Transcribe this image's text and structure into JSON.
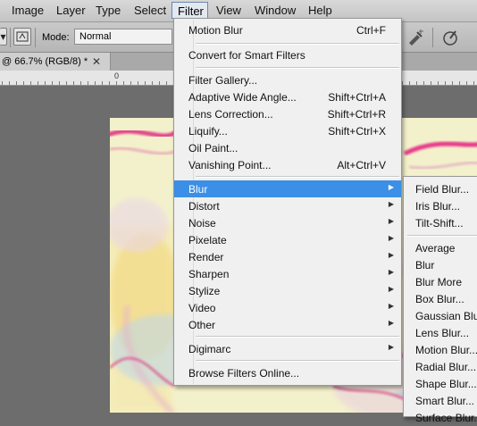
{
  "menubar": {
    "items": [
      "Image",
      "Layer",
      "Type",
      "Select",
      "Filter",
      "View",
      "Window",
      "Help"
    ],
    "active": "Filter"
  },
  "options_bar": {
    "mode_label": "Mode:",
    "mode_value": "Normal"
  },
  "document": {
    "tab_title": "@ 66.7% (RGB/8) *",
    "ruler_zero": "0"
  },
  "filter_menu": {
    "last_filter": {
      "label": "Motion Blur",
      "shortcut": "Ctrl+F"
    },
    "convert": "Convert for Smart Filters",
    "gallery_items": [
      {
        "label": "Filter Gallery...",
        "shortcut": ""
      },
      {
        "label": "Adaptive Wide Angle...",
        "shortcut": "Shift+Ctrl+A"
      },
      {
        "label": "Lens Correction...",
        "shortcut": "Shift+Ctrl+R"
      },
      {
        "label": "Liquify...",
        "shortcut": "Shift+Ctrl+X"
      },
      {
        "label": "Oil Paint...",
        "shortcut": ""
      },
      {
        "label": "Vanishing Point...",
        "shortcut": "Alt+Ctrl+V"
      }
    ],
    "submenus": [
      "Blur",
      "Distort",
      "Noise",
      "Pixelate",
      "Render",
      "Sharpen",
      "Stylize",
      "Video",
      "Other"
    ],
    "highlighted": "Blur",
    "digimarc": "Digimarc",
    "browse": "Browse Filters Online..."
  },
  "blur_menu": {
    "group1": [
      "Field Blur...",
      "Iris Blur...",
      "Tilt-Shift..."
    ],
    "group2": [
      "Average",
      "Blur",
      "Blur More",
      "Box Blur...",
      "Gaussian Blur...",
      "Lens Blur...",
      "Motion Blur...",
      "Radial Blur...",
      "Shape Blur...",
      "Smart Blur...",
      "Surface Blur..."
    ]
  },
  "icons": [
    "brush-preset-icon",
    "airbrush-icon",
    "pressure-icon",
    "chevron-down-icon",
    "close-icon",
    "submenu-arrow-icon"
  ],
  "colors": {
    "highlight": "#3b8fe6",
    "canvas_base": "#f2f0c8",
    "workspace": "#6d6d6d"
  }
}
